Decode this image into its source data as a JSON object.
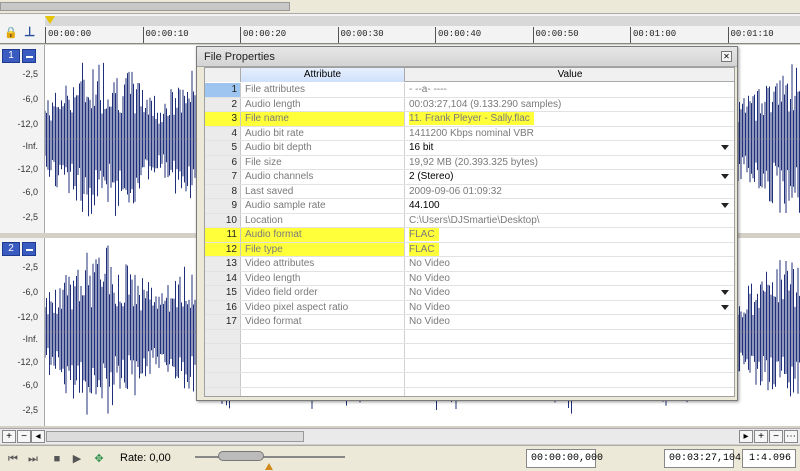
{
  "ruler": {
    "ticks": [
      "00:00:00",
      "00:00:10",
      "00:00:20",
      "00:00:30",
      "00:00:40",
      "00:00:50",
      "00:01:00",
      "00:01:10"
    ]
  },
  "channels": [
    {
      "num": "1",
      "db_labels": [
        "-2,5",
        "-6,0",
        "-12,0",
        "-Inf.",
        "-12,0",
        "-6,0",
        "-2,5"
      ]
    },
    {
      "num": "2",
      "db_labels": [
        "-2,5",
        "-6,0",
        "-12,0",
        "-Inf.",
        "-12,0",
        "-6,0",
        "-2,5"
      ]
    }
  ],
  "colors": {
    "waveform": "#1f2f7a",
    "highlight": "#ffff3a",
    "channel_badge": "#3a5bc0"
  },
  "transport": {
    "rate_label": "Rate: 0,00",
    "time_start": "00:00:00,000",
    "time_length": "00:03:27,104",
    "zoom": "1:4.096"
  },
  "dialog": {
    "title": "File Properties",
    "col_attribute": "Attribute",
    "col_value": "Value",
    "rows": [
      {
        "num": "1",
        "attr": "File attributes",
        "value": "- --a- ----",
        "hl": false,
        "editable": false,
        "dropdown": false
      },
      {
        "num": "2",
        "attr": "Audio length",
        "value": "00:03:27,104 (9.133.290 samples)",
        "hl": false,
        "editable": false,
        "dropdown": false
      },
      {
        "num": "3",
        "attr": "File name",
        "value": "11. Frank Pleyer - Sally.flac",
        "hl": true,
        "editable": false,
        "dropdown": false
      },
      {
        "num": "4",
        "attr": "Audio bit rate",
        "value": "1411200 Kbps nominal VBR",
        "hl": false,
        "editable": false,
        "dropdown": false
      },
      {
        "num": "5",
        "attr": "Audio bit depth",
        "value": "16 bit",
        "hl": false,
        "editable": true,
        "dropdown": true
      },
      {
        "num": "6",
        "attr": "File size",
        "value": "19,92 MB (20.393.325 bytes)",
        "hl": false,
        "editable": false,
        "dropdown": false
      },
      {
        "num": "7",
        "attr": "Audio channels",
        "value": "2  (Stereo)",
        "hl": false,
        "editable": true,
        "dropdown": true
      },
      {
        "num": "8",
        "attr": "Last saved",
        "value": "2009-09-06  01:09:32",
        "hl": false,
        "editable": false,
        "dropdown": false
      },
      {
        "num": "9",
        "attr": "Audio sample rate",
        "value": "44.100",
        "hl": false,
        "editable": true,
        "dropdown": true
      },
      {
        "num": "10",
        "attr": "Location",
        "value": "C:\\Users\\DJSmartie\\Desktop\\",
        "hl": false,
        "editable": false,
        "dropdown": false
      },
      {
        "num": "11",
        "attr": "Audio format",
        "value": "FLAC",
        "hl": true,
        "editable": false,
        "dropdown": false
      },
      {
        "num": "12",
        "attr": "File type",
        "value": "FLAC",
        "hl": true,
        "editable": false,
        "dropdown": false
      },
      {
        "num": "13",
        "attr": "Video attributes",
        "value": "No Video",
        "hl": false,
        "editable": false,
        "dropdown": false
      },
      {
        "num": "14",
        "attr": "Video length",
        "value": "No Video",
        "hl": false,
        "editable": false,
        "dropdown": false
      },
      {
        "num": "15",
        "attr": "Video field order",
        "value": "No Video",
        "hl": false,
        "editable": false,
        "dropdown": true
      },
      {
        "num": "16",
        "attr": "Video pixel aspect ratio",
        "value": "No Video",
        "hl": false,
        "editable": false,
        "dropdown": true
      },
      {
        "num": "17",
        "attr": "Video format",
        "value": "No Video",
        "hl": false,
        "editable": false,
        "dropdown": false
      }
    ]
  }
}
